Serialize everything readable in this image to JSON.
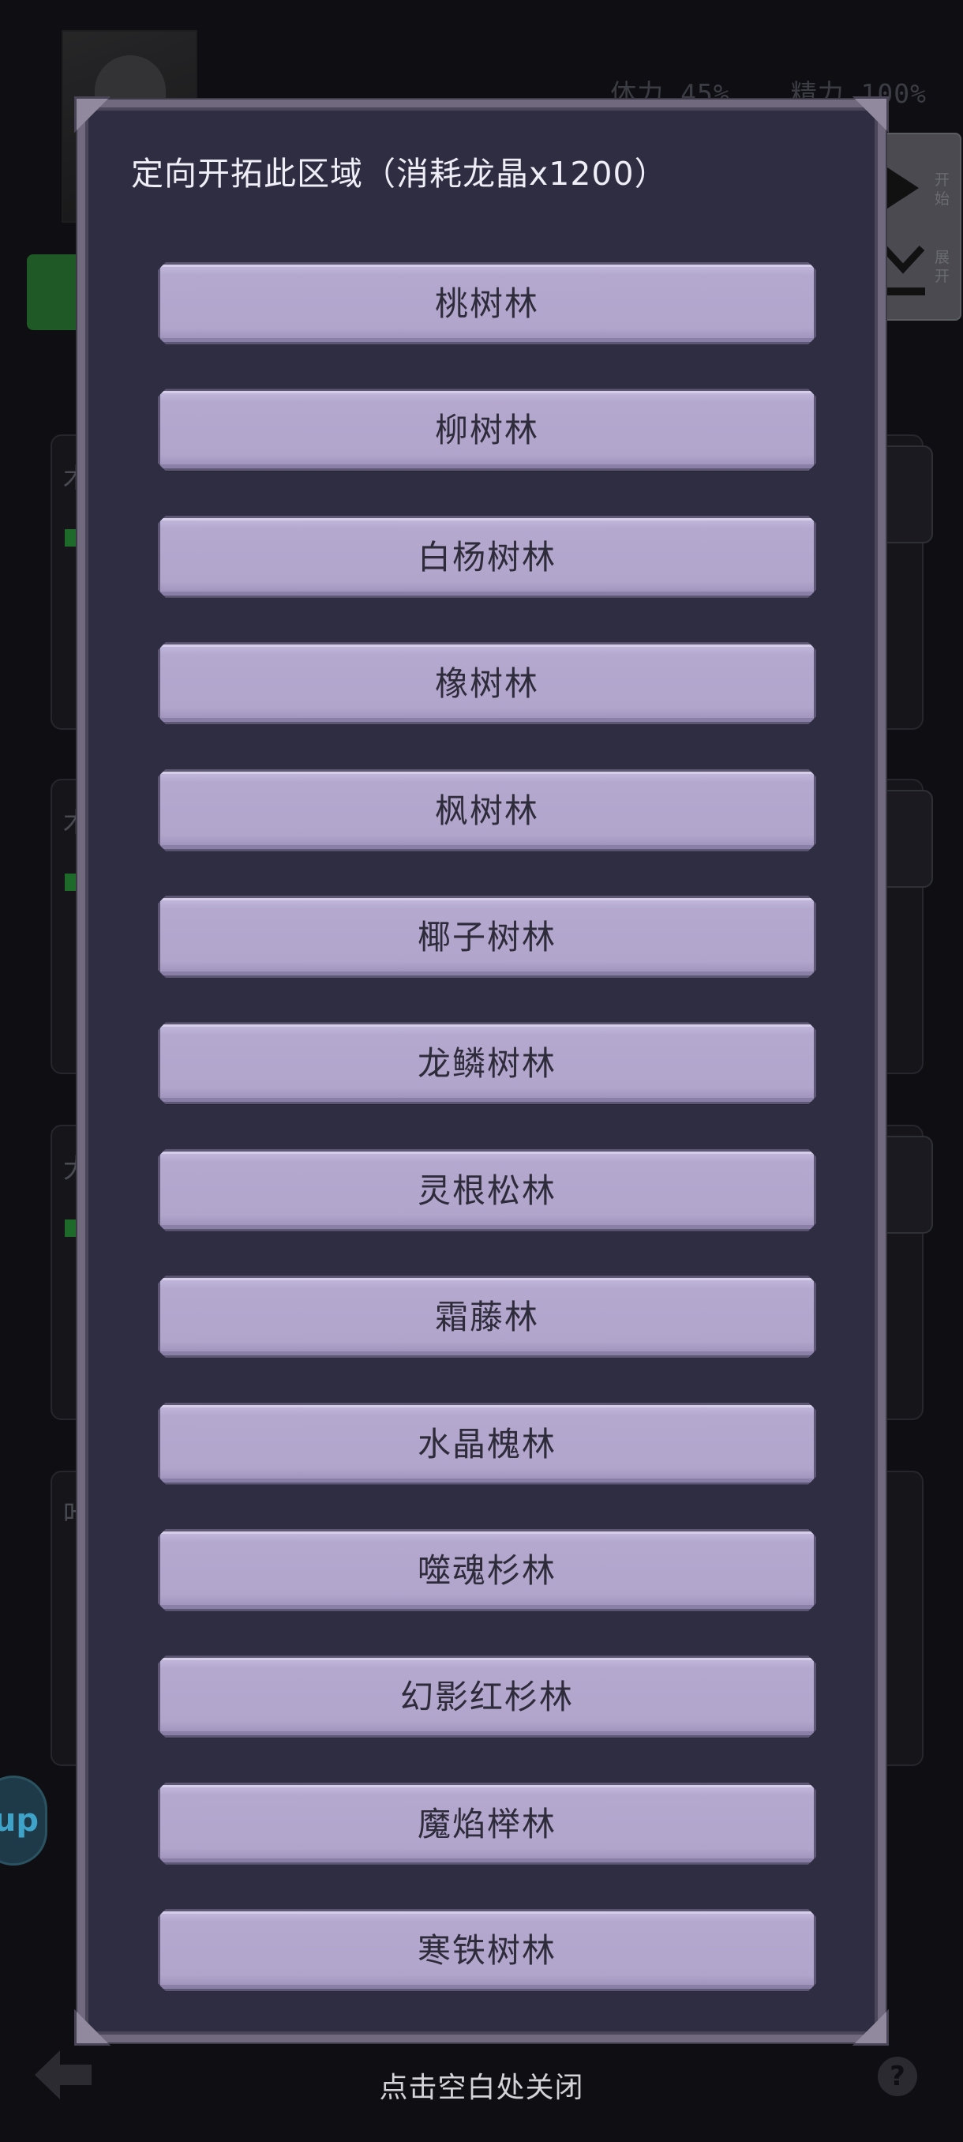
{
  "background": {
    "stats": {
      "stamina": "体力 45%",
      "energy": "精力 100%"
    },
    "side_panel": {
      "start_label": "开始",
      "expand_label": "展开"
    },
    "up_button_label": "up",
    "help_label": "?"
  },
  "modal": {
    "title": "定向开拓此区域（消耗龙晶x1200）",
    "regions": [
      "桃树林",
      "柳树林",
      "白杨树林",
      "橡树林",
      "枫树林",
      "椰子树林",
      "龙鳞树林",
      "灵根松林",
      "霜藤林",
      "水晶槐林",
      "噬魂杉林",
      "幻影红杉林",
      "魔焰榉林",
      "寒铁树林"
    ]
  },
  "footer": {
    "close_hint": "点击空白处关闭"
  },
  "colors": {
    "modal_bg": "#2f2d41",
    "button_bg": "#b1a5cc",
    "button_text": "#2e2b3a",
    "page_bg": "#0f0f13"
  }
}
